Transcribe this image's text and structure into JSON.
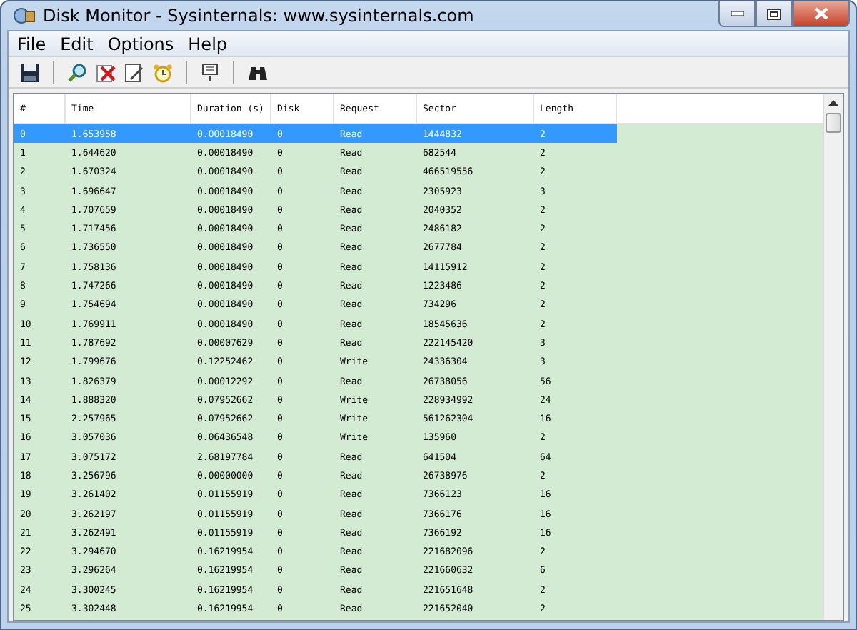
{
  "window": {
    "title": "Disk Monitor - Sysinternals: www.sysinternals.com"
  },
  "menu": [
    "File",
    "Edit",
    "Options",
    "Help"
  ],
  "table": {
    "columns": [
      "#",
      "Time",
      "Duration (s)",
      "Disk",
      "Request",
      "Sector",
      "Length"
    ],
    "rows": [
      {
        "cells": [
          "0",
          "1.653958",
          "0.00018490",
          "0",
          "Read",
          "1444832",
          "2"
        ],
        "selected": true
      },
      {
        "cells": [
          "1",
          "1.644620",
          "0.00018490",
          "0",
          "Read",
          "682544",
          "2"
        ],
        "selected": false
      },
      {
        "cells": [
          "2",
          "1.670324",
          "0.00018490",
          "0",
          "Read",
          "466519556",
          "2"
        ],
        "selected": false
      },
      {
        "cells": [
          "3",
          "1.696647",
          "0.00018490",
          "0",
          "Read",
          "2305923",
          "3"
        ],
        "selected": false
      },
      {
        "cells": [
          "4",
          "1.707659",
          "0.00018490",
          "0",
          "Read",
          "2040352",
          "2"
        ],
        "selected": false
      },
      {
        "cells": [
          "5",
          "1.717456",
          "0.00018490",
          "0",
          "Read",
          "2486182",
          "2"
        ],
        "selected": false
      },
      {
        "cells": [
          "6",
          "1.736550",
          "0.00018490",
          "0",
          "Read",
          "2677784",
          "2"
        ],
        "selected": false
      },
      {
        "cells": [
          "7",
          "1.758136",
          "0.00018490",
          "0",
          "Read",
          "14115912",
          "2"
        ],
        "selected": false
      },
      {
        "cells": [
          "8",
          "1.747266",
          "0.00018490",
          "0",
          "Read",
          "1223486",
          "2"
        ],
        "selected": false
      },
      {
        "cells": [
          "9",
          "1.754694",
          "0.00018490",
          "0",
          "Read",
          "734296",
          "2"
        ],
        "selected": false
      },
      {
        "cells": [
          "10",
          "1.769911",
          "0.00018490",
          "0",
          "Read",
          "18545636",
          "2"
        ],
        "selected": false
      },
      {
        "cells": [
          "11",
          "1.787692",
          "0.00007629",
          "0",
          "Read",
          "222145420",
          "3"
        ],
        "selected": false
      },
      {
        "cells": [
          "12",
          "1.799676",
          "0.12252462",
          "0",
          "Write",
          "24336304",
          "3"
        ],
        "selected": false
      },
      {
        "cells": [
          "13",
          "1.826379",
          "0.00012292",
          "0",
          "Read",
          "26738056",
          "56"
        ],
        "selected": false
      },
      {
        "cells": [
          "14",
          "1.888320",
          "0.07952662",
          "0",
          "Write",
          "228934992",
          "24"
        ],
        "selected": false
      },
      {
        "cells": [
          "15",
          "2.257965",
          "0.07952662",
          "0",
          "Write",
          "561262304",
          "16"
        ],
        "selected": false
      },
      {
        "cells": [
          "16",
          "3.057036",
          "0.06436548",
          "0",
          "Write",
          "135960",
          "2"
        ],
        "selected": false
      },
      {
        "cells": [
          "17",
          "3.075172",
          "2.68197784",
          "0",
          "Read",
          "641504",
          "64"
        ],
        "selected": false
      },
      {
        "cells": [
          "18",
          "3.256796",
          "0.00000000",
          "0",
          "Read",
          "26738976",
          "2"
        ],
        "selected": false
      },
      {
        "cells": [
          "19",
          "3.261402",
          "0.01155919",
          "0",
          "Read",
          "7366123",
          "16"
        ],
        "selected": false
      },
      {
        "cells": [
          "20",
          "3.262197",
          "0.01155919",
          "0",
          "Read",
          "7366176",
          "16"
        ],
        "selected": false
      },
      {
        "cells": [
          "21",
          "3.262491",
          "0.01155919",
          "0",
          "Read",
          "7366192",
          "16"
        ],
        "selected": false
      },
      {
        "cells": [
          "22",
          "3.294670",
          "0.16219954",
          "0",
          "Read",
          "221682096",
          "2"
        ],
        "selected": false
      },
      {
        "cells": [
          "23",
          "3.296264",
          "0.16219954",
          "0",
          "Read",
          "221660632",
          "6"
        ],
        "selected": false
      },
      {
        "cells": [
          "24",
          "3.300245",
          "0.16219954",
          "0",
          "Read",
          "221651648",
          "2"
        ],
        "selected": false
      },
      {
        "cells": [
          "25",
          "3.302448",
          "0.16219954",
          "0",
          "Read",
          "221652040",
          "2"
        ],
        "selected": false
      }
    ]
  }
}
